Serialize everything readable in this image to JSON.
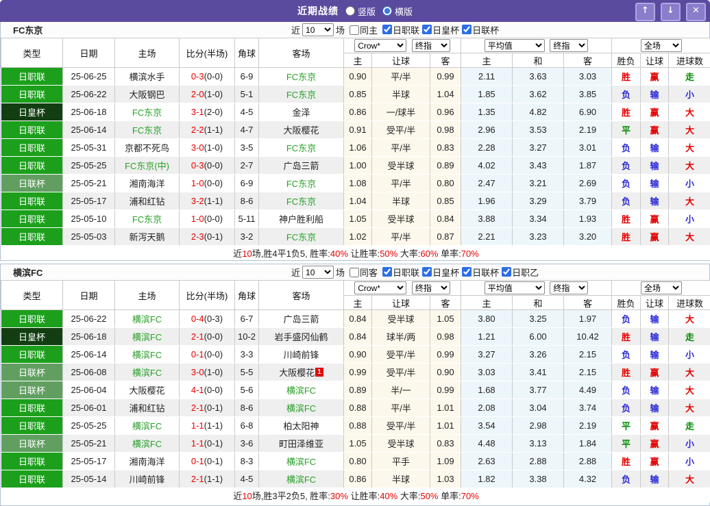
{
  "color_map": {
    "胜": "c-red",
    "赢": "c-red",
    "大": "c-red",
    "负": "c-blue",
    "输": "c-blue",
    "小": "c-blue",
    "平": "c-green",
    "走": "c-green",
    "日职联": "t-j1",
    "日皇杯": "t-emp",
    "日联杯": "t-cup",
    "日职乙": "t-j1"
  },
  "colors": {
    "titlebar": "#5b4b9e",
    "league_bright": "#1ca01c",
    "league_cup": "#619f61",
    "league_emperor": "#123e12",
    "win_red": "#e60000",
    "lose_blue": "#2929d6",
    "draw_green": "#008b00",
    "team_green": "#28a028",
    "odds_bg": "#fdf8ec",
    "avg_bg": "#edf6fa"
  },
  "titlebar": {
    "title": "近期战绩",
    "radio_vertical": "竖版",
    "radio_horizontal": "横版",
    "selected_mode": "横版",
    "btn_up": "↑",
    "btn_down": "↓",
    "btn_close": "✕"
  },
  "controls": {
    "recent": "近",
    "count": "10",
    "games": "场"
  },
  "header": {
    "col_type": "类型",
    "col_date": "日期",
    "col_home": "主场",
    "col_score": "比分(半场)",
    "col_corner": "角球",
    "col_away": "客场",
    "odds_source": "Crow*",
    "odds_stage": "终指",
    "avg_source": "平均值",
    "avg_stage": "终指",
    "scope": "全场",
    "sub_home": "主",
    "sub_handicap": "让球",
    "sub_away": "客",
    "sub_avg_home": "主",
    "sub_avg_draw": "和",
    "sub_avg_away": "客",
    "sub_result": "胜负",
    "sub_hresult": "让球",
    "sub_goals": "进球数"
  },
  "tables": [
    {
      "team": "FC东京",
      "same_label": "同主",
      "leagues": [
        "日职联",
        "日皇杯",
        "日联杯"
      ],
      "rows": [
        {
          "type": "日职联",
          "date": "25-06-25",
          "home": "横滨水手",
          "home_cls": "",
          "score": "0-3",
          "half": "(0-0)",
          "corner": "6-9",
          "away": "FC东京",
          "away_cls": "tm",
          "o1": "0.90",
          "hd": "平/半",
          "o2": "0.99",
          "m1": "2.11",
          "m2": "3.63",
          "m3": "3.03",
          "r1": "胜",
          "r2": "赢",
          "r3": "走"
        },
        {
          "type": "日职联",
          "date": "25-06-22",
          "home": "大阪钢巴",
          "home_cls": "",
          "score": "2-0",
          "half": "(1-0)",
          "corner": "5-1",
          "away": "FC东京",
          "away_cls": "tm",
          "o1": "0.85",
          "hd": "半球",
          "o2": "1.04",
          "m1": "1.85",
          "m2": "3.62",
          "m3": "3.85",
          "r1": "负",
          "r2": "输",
          "r3": "小"
        },
        {
          "type": "日皇杯",
          "date": "25-06-18",
          "home": "FC东京",
          "home_cls": "tm",
          "score": "3-1",
          "half": "(2-0)",
          "corner": "4-5",
          "away": "金泽",
          "away_cls": "",
          "o1": "0.86",
          "hd": "一/球半",
          "o2": "0.96",
          "m1": "1.35",
          "m2": "4.82",
          "m3": "6.90",
          "r1": "胜",
          "r2": "赢",
          "r3": "大"
        },
        {
          "type": "日职联",
          "date": "25-06-14",
          "home": "FC东京",
          "home_cls": "tm",
          "score": "2-2",
          "half": "(1-1)",
          "corner": "4-7",
          "away": "大阪樱花",
          "away_cls": "",
          "o1": "0.91",
          "hd": "受平/半",
          "o2": "0.98",
          "m1": "2.96",
          "m2": "3.53",
          "m3": "2.19",
          "r1": "平",
          "r2": "赢",
          "r3": "大"
        },
        {
          "type": "日职联",
          "date": "25-05-31",
          "home": "京都不死鸟",
          "home_cls": "",
          "score": "3-0",
          "half": "(1-0)",
          "corner": "3-5",
          "away": "FC东京",
          "away_cls": "tm",
          "o1": "1.06",
          "hd": "平/半",
          "o2": "0.83",
          "m1": "2.28",
          "m2": "3.27",
          "m3": "3.01",
          "r1": "负",
          "r2": "输",
          "r3": "大"
        },
        {
          "type": "日职联",
          "date": "25-05-25",
          "home": "FC东京(中)",
          "home_cls": "tm",
          "score": "0-3",
          "half": "(0-0)",
          "corner": "2-7",
          "away": "广岛三箭",
          "away_cls": "",
          "o1": "1.00",
          "hd": "受半球",
          "o2": "0.89",
          "m1": "4.02",
          "m2": "3.43",
          "m3": "1.87",
          "r1": "负",
          "r2": "输",
          "r3": "大"
        },
        {
          "type": "日联杯",
          "date": "25-05-21",
          "home": "湘南海洋",
          "home_cls": "",
          "score": "1-0",
          "half": "(0-0)",
          "corner": "6-9",
          "away": "FC东京",
          "away_cls": "tm",
          "o1": "1.08",
          "hd": "平/半",
          "o2": "0.80",
          "m1": "2.47",
          "m2": "3.21",
          "m3": "2.69",
          "r1": "负",
          "r2": "输",
          "r3": "小"
        },
        {
          "type": "日职联",
          "date": "25-05-17",
          "home": "浦和红钻",
          "home_cls": "",
          "score": "3-2",
          "half": "(1-1)",
          "corner": "8-6",
          "away": "FC东京",
          "away_cls": "tm",
          "o1": "1.04",
          "hd": "半球",
          "o2": "0.85",
          "m1": "1.96",
          "m2": "3.29",
          "m3": "3.79",
          "r1": "负",
          "r2": "输",
          "r3": "大"
        },
        {
          "type": "日职联",
          "date": "25-05-10",
          "home": "FC东京",
          "home_cls": "tm",
          "score": "1-0",
          "half": "(0-0)",
          "corner": "5-11",
          "away": "神户胜利船",
          "away_cls": "",
          "o1": "1.05",
          "hd": "受半球",
          "o2": "0.84",
          "m1": "3.88",
          "m2": "3.34",
          "m3": "1.93",
          "r1": "胜",
          "r2": "赢",
          "r3": "小"
        },
        {
          "type": "日职联",
          "date": "25-05-03",
          "home": "新泻天鹅",
          "home_cls": "",
          "score": "2-3",
          "half": "(0-1)",
          "corner": "3-2",
          "away": "FC东京",
          "away_cls": "tm",
          "o1": "1.02",
          "hd": "平/半",
          "o2": "0.87",
          "m1": "2.21",
          "m2": "3.23",
          "m3": "3.20",
          "r1": "胜",
          "r2": "赢",
          "r3": "大"
        }
      ],
      "summary": [
        {
          "t": "近"
        },
        {
          "t": "10",
          "c": "c-red"
        },
        {
          "t": "场,胜4平1负5, 胜率:"
        },
        {
          "t": "40%",
          "c": "c-red"
        },
        {
          "t": " 让胜率:"
        },
        {
          "t": "50%",
          "c": "c-red"
        },
        {
          "t": " 大率:"
        },
        {
          "t": "60%",
          "c": "c-red"
        },
        {
          "t": " 单率:"
        },
        {
          "t": "70%",
          "c": "c-red"
        }
      ]
    },
    {
      "team": "横滨FC",
      "same_label": "同客",
      "leagues": [
        "日职联",
        "日皇杯",
        "日联杯",
        "日职乙"
      ],
      "rows": [
        {
          "type": "日职联",
          "date": "25-06-22",
          "home": "横滨FC",
          "home_cls": "tm",
          "score": "0-4",
          "half": "(0-3)",
          "corner": "6-7",
          "away": "广岛三箭",
          "away_cls": "",
          "o1": "0.84",
          "hd": "受半球",
          "o2": "1.05",
          "m1": "3.80",
          "m2": "3.25",
          "m3": "1.97",
          "r1": "负",
          "r2": "输",
          "r3": "大"
        },
        {
          "type": "日皇杯",
          "date": "25-06-18",
          "home": "横滨FC",
          "home_cls": "tm",
          "score": "2-1",
          "half": "(0-0)",
          "corner": "10-2",
          "away": "岩手盛冈仙鹤",
          "away_cls": "",
          "o1": "0.84",
          "hd": "球半/两",
          "o2": "0.98",
          "m1": "1.21",
          "m2": "6.00",
          "m3": "10.42",
          "r1": "胜",
          "r2": "输",
          "r3": "走"
        },
        {
          "type": "日职联",
          "date": "25-06-14",
          "home": "横滨FC",
          "home_cls": "tm",
          "score": "0-1",
          "half": "(0-0)",
          "corner": "3-3",
          "away": "川崎前锋",
          "away_cls": "",
          "o1": "0.90",
          "hd": "受平/半",
          "o2": "0.99",
          "m1": "3.27",
          "m2": "3.26",
          "m3": "2.15",
          "r1": "负",
          "r2": "输",
          "r3": "小"
        },
        {
          "type": "日联杯",
          "date": "25-06-08",
          "home": "横滨FC",
          "home_cls": "tm",
          "score": "3-0",
          "half": "(1-0)",
          "corner": "5-5",
          "away": "大阪樱花",
          "away_cls": "",
          "away_badge": "1",
          "o1": "0.99",
          "hd": "受平/半",
          "o2": "0.90",
          "m1": "3.03",
          "m2": "3.41",
          "m3": "2.15",
          "r1": "胜",
          "r2": "赢",
          "r3": "大"
        },
        {
          "type": "日联杯",
          "date": "25-06-04",
          "home": "大阪樱花",
          "home_cls": "",
          "score": "4-1",
          "half": "(0-0)",
          "corner": "5-6",
          "away": "横滨FC",
          "away_cls": "tm",
          "o1": "0.89",
          "hd": "半/一",
          "o2": "0.99",
          "m1": "1.68",
          "m2": "3.77",
          "m3": "4.49",
          "r1": "负",
          "r2": "输",
          "r3": "大"
        },
        {
          "type": "日职联",
          "date": "25-06-01",
          "home": "浦和红钻",
          "home_cls": "",
          "score": "2-1",
          "half": "(0-1)",
          "corner": "8-6",
          "away": "横滨FC",
          "away_cls": "tm",
          "o1": "0.88",
          "hd": "平/半",
          "o2": "1.01",
          "m1": "2.08",
          "m2": "3.04",
          "m3": "3.74",
          "r1": "负",
          "r2": "输",
          "r3": "大"
        },
        {
          "type": "日职联",
          "date": "25-05-25",
          "home": "横滨FC",
          "home_cls": "tm",
          "score": "1-1",
          "half": "(1-1)",
          "corner": "6-8",
          "away": "柏太阳神",
          "away_cls": "",
          "o1": "0.88",
          "hd": "受平/半",
          "o2": "1.01",
          "m1": "3.54",
          "m2": "2.98",
          "m3": "2.19",
          "r1": "平",
          "r2": "赢",
          "r3": "走"
        },
        {
          "type": "日联杯",
          "date": "25-05-21",
          "home": "横滨FC",
          "home_cls": "tm",
          "score": "1-1",
          "half": "(0-1)",
          "corner": "3-6",
          "away": "町田泽维亚",
          "away_cls": "",
          "o1": "1.05",
          "hd": "受半球",
          "o2": "0.83",
          "m1": "4.48",
          "m2": "3.13",
          "m3": "1.84",
          "r1": "平",
          "r2": "赢",
          "r3": "小"
        },
        {
          "type": "日职联",
          "date": "25-05-17",
          "home": "湘南海洋",
          "home_cls": "",
          "score": "0-1",
          "half": "(0-1)",
          "corner": "8-3",
          "away": "横滨FC",
          "away_cls": "tm",
          "o1": "0.80",
          "hd": "平手",
          "o2": "1.09",
          "m1": "2.63",
          "m2": "2.88",
          "m3": "2.88",
          "r1": "胜",
          "r2": "赢",
          "r3": "小"
        },
        {
          "type": "日职联",
          "date": "25-05-14",
          "home": "川崎前锋",
          "home_cls": "",
          "score": "2-1",
          "half": "(1-1)",
          "corner": "4-5",
          "away": "横滨FC",
          "away_cls": "tm",
          "o1": "0.86",
          "hd": "半球",
          "o2": "1.03",
          "m1": "1.82",
          "m2": "3.38",
          "m3": "4.32",
          "r1": "负",
          "r2": "输",
          "r3": "大"
        }
      ],
      "summary": [
        {
          "t": "近"
        },
        {
          "t": "10",
          "c": "c-red"
        },
        {
          "t": "场,胜3平2负5, 胜率:"
        },
        {
          "t": "30%",
          "c": "c-red"
        },
        {
          "t": " 让胜率:"
        },
        {
          "t": "40%",
          "c": "c-red"
        },
        {
          "t": " 大率:"
        },
        {
          "t": "50%",
          "c": "c-red"
        },
        {
          "t": " 单率:"
        },
        {
          "t": "70%",
          "c": "c-red"
        }
      ]
    }
  ]
}
